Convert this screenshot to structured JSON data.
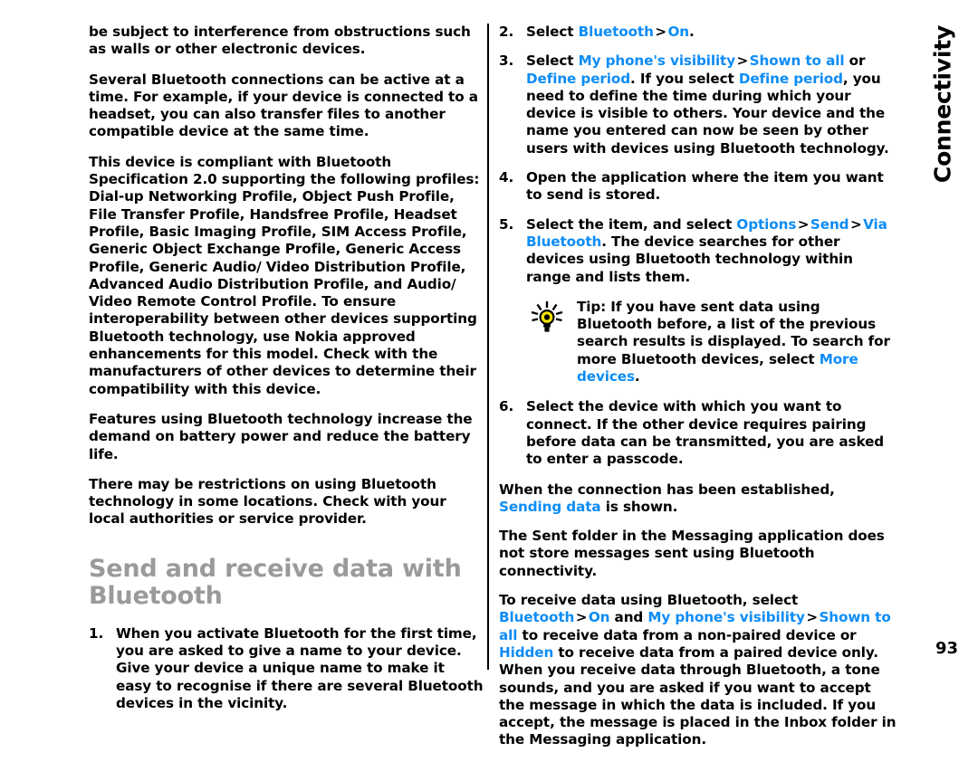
{
  "document": {
    "side_tab_label": "Connectivity",
    "page_number": "93",
    "accent_link_color": "#0d8cf5",
    "heading_color": "#9a9a9a"
  },
  "left_column": {
    "paragraphs": [
      "be subject to interference from obstructions such as walls or other electronic devices.",
      "Several Bluetooth connections can be active at a time. For example, if your device is connected to a headset, you can also transfer files to another compatible device at the same time.",
      "This device is compliant with Bluetooth Specification 2.0 supporting the following profiles: Dial-up Networking Profile, Object Push Profile, File Transfer Profile, Handsfree Profile, Headset Profile, Basic Imaging Profile, SIM Access Profile, Generic Object Exchange Profile, Generic Access Profile, Generic Audio/ Video Distribution Profile, Advanced Audio Distribution Profile, and Audio/ Video Remote Control Profile. To ensure interoperability between other devices supporting Bluetooth technology, use Nokia approved enhancements for this model. Check with the manufacturers of other devices to determine their compatibility with this device.",
      "Features using Bluetooth technology increase the demand on battery power and reduce the battery life.",
      "There may be restrictions on using Bluetooth technology in some locations. Check with your local authorities or service provider."
    ],
    "section_heading": "Send and receive data with Bluetooth",
    "step_1": {
      "number": "1.",
      "text": "When you activate Bluetooth for the first time, you are asked to give a name to your device. Give your device a unique name to make it easy to recognise if there are several Bluetooth devices in the vicinity."
    }
  },
  "right_column": {
    "step_2": {
      "number": "2.",
      "prefix": "Select ",
      "link_1": "Bluetooth",
      "sep_1": ">",
      "link_2": "On",
      "suffix": "."
    },
    "step_3": {
      "number": "3.",
      "prefix": "Select ",
      "link_1": "My phone's visibility",
      "sep_1": ">",
      "link_2": "Shown to all",
      "mid_1": " or ",
      "link_3": "Define period",
      "mid_2": ". If you select ",
      "link_4": "Define period",
      "suffix": ", you need to define the time during which your device is visible to others. Your device and the name you entered can now be seen by other users with devices using Bluetooth technology."
    },
    "step_4": {
      "number": "4.",
      "text": "Open the application where the item you want to send is stored."
    },
    "step_5": {
      "number": "5.",
      "prefix": "Select the item, and select ",
      "link_1": "Options",
      "sep_1": ">",
      "link_2": "Send",
      "sep_2": ">",
      "link_3": "Via Bluetooth",
      "suffix": ". The device searches for other devices using Bluetooth technology within range and lists them."
    },
    "tip": {
      "icon_name": "lightbulb-icon",
      "label": "Tip:",
      "text_1": " If you have sent data using Bluetooth before, a list of the previous search results is displayed. To search for more Bluetooth devices, select ",
      "link_1": "More devices",
      "text_2": "."
    },
    "step_6": {
      "number": "6.",
      "text": "Select the device with which you want to connect. If the other device requires pairing before data can be transmitted, you are asked to enter a passcode."
    },
    "para_sending": {
      "prefix": "When the connection has been established, ",
      "link_1": "Sending data",
      "suffix": " is shown."
    },
    "para_sent_folder": "The Sent folder in the Messaging application does not store messages sent using Bluetooth connectivity.",
    "para_receive": {
      "prefix": "To receive data using Bluetooth, select ",
      "link_1": "Bluetooth",
      "sep_1": ">",
      "link_2": "On",
      "mid_1": " and ",
      "link_3": "My phone's visibility",
      "sep_2": ">",
      "link_4": "Shown to all",
      "mid_2": " to receive data from a non-paired device or ",
      "link_5": "Hidden",
      "suffix": " to receive data from a paired device only. When you receive data through Bluetooth, a tone sounds, and you are asked if you want to accept the message in which the data is included. If you accept, the message is placed in the Inbox folder in the Messaging application."
    }
  }
}
